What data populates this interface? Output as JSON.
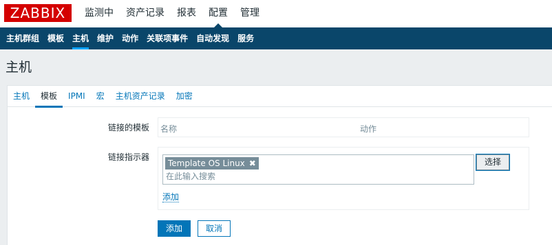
{
  "brand": {
    "logo": "ZABBIX",
    "logo_color": "#d40000",
    "nav_color": "#0a466a",
    "accent": "#0275b8"
  },
  "main_menu": [
    {
      "label": "监测中"
    },
    {
      "label": "资产记录"
    },
    {
      "label": "报表"
    },
    {
      "label": "配置",
      "active": true
    },
    {
      "label": "管理"
    }
  ],
  "sub_menu": [
    {
      "label": "主机群组"
    },
    {
      "label": "模板"
    },
    {
      "label": "主机",
      "active": true
    },
    {
      "label": "维护"
    },
    {
      "label": "动作"
    },
    {
      "label": "关联项事件"
    },
    {
      "label": "自动发现"
    },
    {
      "label": "服务"
    }
  ],
  "page": {
    "title": "主机"
  },
  "tabs": [
    {
      "label": "主机"
    },
    {
      "label": "模板",
      "active": true
    },
    {
      "label": "IPMI"
    },
    {
      "label": "宏"
    },
    {
      "label": "主机资产记录"
    },
    {
      "label": "加密"
    }
  ],
  "form": {
    "linked_templates": {
      "label": "链接的模板",
      "col_name": "名称",
      "col_action": "动作"
    },
    "link_indicator": {
      "label": "链接指示器",
      "selected_tag": "Template OS Linux",
      "remove_icon": "close-icon",
      "placeholder": "在此输入搜索",
      "select_button": "选择",
      "add_link": "添加"
    },
    "buttons": {
      "add": "添加",
      "cancel": "取消"
    }
  }
}
